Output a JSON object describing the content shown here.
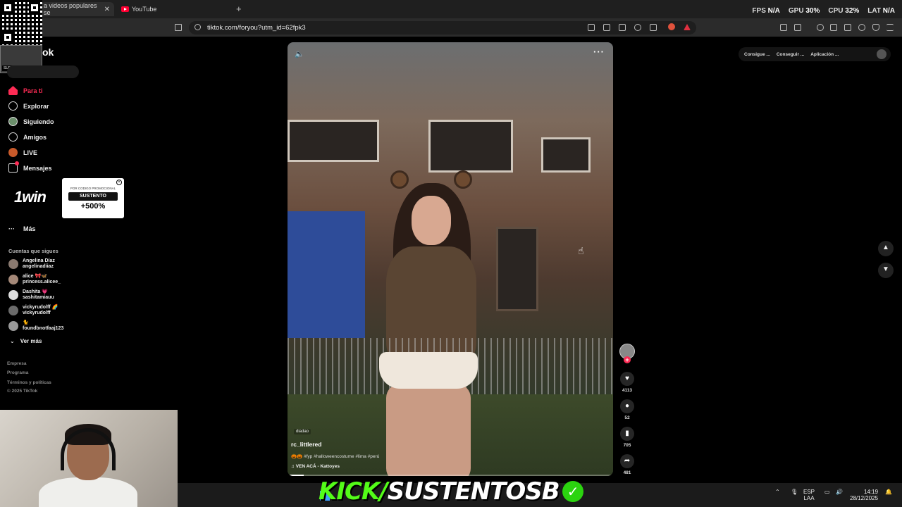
{
  "browser": {
    "tabs": [
      {
        "label": "a videos populares se",
        "active": true
      },
      {
        "label": "YouTube",
        "active": false
      }
    ],
    "new_tab": "+",
    "close": "✕",
    "url": "tiktok.com/foryou?utm_id=62fpk3"
  },
  "overlay_stats": {
    "fps_label": "FPS",
    "fps_value": "N/A",
    "gpu_label": "GPU",
    "gpu_value": "30%",
    "cpu_label": "CPU",
    "cpu_value": "32%",
    "lat_label": "LAT",
    "lat_value": "N/A"
  },
  "qr_overlay": {
    "label": "SUSTENTO"
  },
  "sidebar": {
    "logo_fragment": "ok",
    "nav": [
      {
        "label": "Para ti",
        "icon": "home-icon",
        "active": true
      },
      {
        "label": "Explorar",
        "icon": "compass-icon"
      },
      {
        "label": "Siguiendo",
        "icon": "following-icon"
      },
      {
        "label": "Amigos",
        "icon": "friends-icon"
      },
      {
        "label": "LIVE",
        "icon": "live-icon"
      },
      {
        "label": "Mensajes",
        "icon": "messages-icon"
      }
    ],
    "more_label": "Más",
    "following_heading": "Cuentas que sigues",
    "following": [
      {
        "name": "Angelina Díaz",
        "handle": "angelinadiiaz"
      },
      {
        "name": "alice 🎀🦋",
        "handle": "princess.alicee_"
      },
      {
        "name": "Dashita 💗",
        "handle": "sashitamiauu"
      },
      {
        "name": "vickyrudolff 🌈",
        "handle": "vickyrudolff"
      },
      {
        "name": "🐈",
        "handle": "foundbnotfaaj123"
      }
    ],
    "see_more": "Ver más",
    "footer": [
      "Empresa",
      "Programa",
      "Términos y políticas",
      "© 2025 TikTok"
    ]
  },
  "ad": {
    "logo": "1win",
    "small_text": "POR CODIGO PROMOCIONAL",
    "button": "SUSTENTO",
    "bonus": "+500%"
  },
  "video": {
    "tag": "diadao",
    "username": "rc_littlered",
    "caption": "🎃🎃 #fyp #halloweencostume #lima #perú",
    "music": "VEN ACÁ - Kattoyes",
    "progress": 0.05
  },
  "actions": {
    "likes": "4113",
    "comments": "52",
    "saves": "705",
    "shares": "481"
  },
  "top_right": {
    "buttons": [
      "Consigue ...",
      "Conseguir ...",
      "Aplicación ..."
    ]
  },
  "stream_overlay": {
    "kick_prefix": "KICK/",
    "channel": "SUSTENTOSB"
  },
  "taskbar": {
    "lang_top": "ESP",
    "lang_bottom": "LAA",
    "time": "14:19",
    "date": "28/12/2025"
  }
}
